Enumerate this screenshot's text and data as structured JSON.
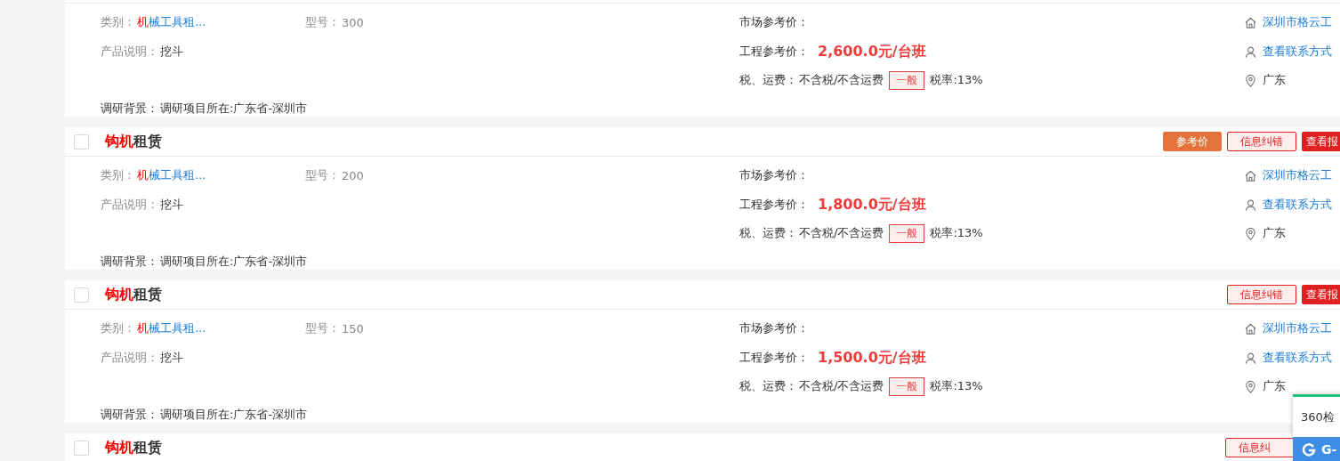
{
  "items": [
    {
      "body": {
        "category_label": "类别：",
        "category": {
          "highlight": "机",
          "rest": "械工具租..."
        },
        "model_label": "型号：",
        "model": "300",
        "desc_label": "产品说明：",
        "desc": "挖斗",
        "market_label": "市场参考价：",
        "eng_label": "工程参考价：",
        "eng_price": "2,600.0元/台班",
        "tax_label": "税、运费：",
        "tax": "不含税/不含运费",
        "tax_tag": "一般",
        "tax_rate": "税率:13%",
        "bg_label": "调研背景：",
        "bg": "调研项目所在:广东省-深圳市",
        "company": "深圳市格云工",
        "contact": "查看联系方式",
        "region": "广东"
      }
    },
    {
      "header": {
        "checked": false,
        "title": {
          "highlight": "钩机",
          "rest": "租赁"
        },
        "buttons": [
          {
            "kind": "reference",
            "label": "参考价"
          },
          {
            "kind": "correction",
            "label": "信息纠错"
          },
          {
            "kind": "report",
            "label": "查看报"
          }
        ]
      },
      "body": {
        "category_label": "类别：",
        "category": {
          "highlight": "机",
          "rest": "械工具租..."
        },
        "model_label": "型号：",
        "model": "200",
        "desc_label": "产品说明：",
        "desc": "挖斗",
        "market_label": "市场参考价：",
        "eng_label": "工程参考价：",
        "eng_price": "1,800.0元/台班",
        "tax_label": "税、运费：",
        "tax": "不含税/不含运费",
        "tax_tag": "一般",
        "tax_rate": "税率:13%",
        "bg_label": "调研背景：",
        "bg": "调研项目所在:广东省-深圳市",
        "company": "深圳市格云工",
        "contact": "查看联系方式",
        "region": "广东"
      }
    },
    {
      "header": {
        "checked": false,
        "title": {
          "highlight": "钩机",
          "rest": "租赁"
        },
        "buttons": [
          {
            "kind": "correction",
            "label": "信息纠错"
          },
          {
            "kind": "report",
            "label": "查看报"
          }
        ]
      },
      "body": {
        "category_label": "类别：",
        "category": {
          "highlight": "机",
          "rest": "械工具租..."
        },
        "model_label": "型号：",
        "model": "150",
        "desc_label": "产品说明：",
        "desc": "挖斗",
        "market_label": "市场参考价：",
        "eng_label": "工程参考价：",
        "eng_price": "1,500.0元/台班",
        "tax_label": "税、运费：",
        "tax": "不含税/不含运费",
        "tax_tag": "一般",
        "tax_rate": "税率:13%",
        "bg_label": "调研背景：",
        "bg": "调研项目所在:广东省-深圳市",
        "company": "深圳市格云工",
        "contact": "查看联系方式",
        "region": "广东"
      }
    },
    {
      "header": {
        "checked": false,
        "title": {
          "highlight": "钩机",
          "rest": "租赁"
        },
        "buttons": [
          {
            "kind": "correction",
            "label": "信息纠"
          }
        ]
      }
    }
  ],
  "popup": {
    "text": "360检",
    "bar_text": "G-"
  }
}
